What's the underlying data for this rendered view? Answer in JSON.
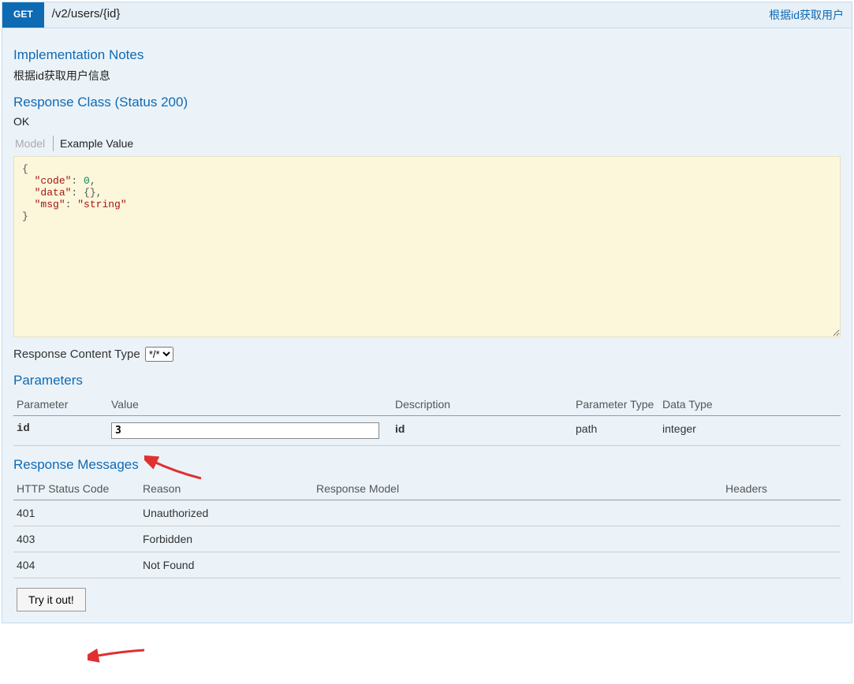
{
  "operation": {
    "method": "GET",
    "path": "/v2/users/{id}",
    "summary": "根据id获取用户"
  },
  "implementation": {
    "title": "Implementation Notes",
    "text": "根据id获取用户信息"
  },
  "responseClass": {
    "title": "Response Class (Status 200)",
    "statusText": "OK",
    "tabs": {
      "model": "Model",
      "example": "Example Value"
    },
    "example": {
      "code": 0,
      "data": {},
      "msg": "string"
    }
  },
  "responseContentType": {
    "label": "Response Content Type",
    "options": [
      "*/*"
    ],
    "selected": "*/*"
  },
  "parameters": {
    "title": "Parameters",
    "headers": {
      "parameter": "Parameter",
      "value": "Value",
      "description": "Description",
      "paramType": "Parameter Type",
      "dataType": "Data Type"
    },
    "rows": [
      {
        "name": "id",
        "value": "3",
        "description": "id",
        "paramType": "path",
        "dataType": "integer"
      }
    ]
  },
  "responseMessages": {
    "title": "Response Messages",
    "headers": {
      "code": "HTTP Status Code",
      "reason": "Reason",
      "model": "Response Model",
      "headers": "Headers"
    },
    "rows": [
      {
        "code": "401",
        "reason": "Unauthorized"
      },
      {
        "code": "403",
        "reason": "Forbidden"
      },
      {
        "code": "404",
        "reason": "Not Found"
      }
    ]
  },
  "tryButton": {
    "label": "Try it out!"
  }
}
